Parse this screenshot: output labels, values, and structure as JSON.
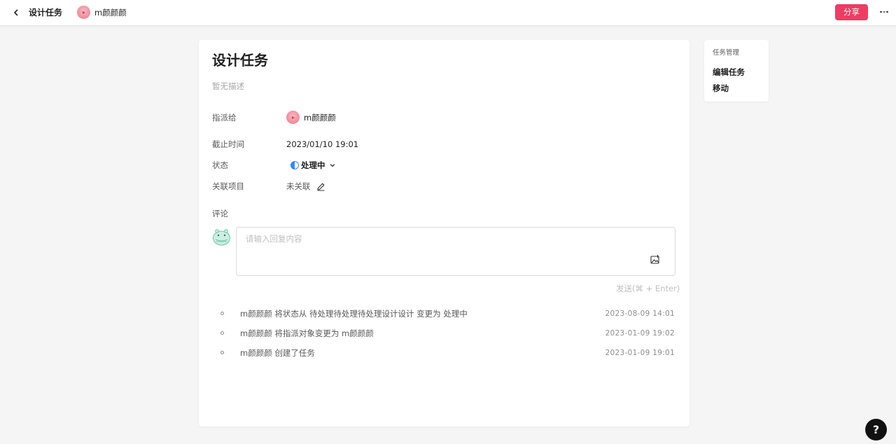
{
  "topbar": {
    "title": "设计任务",
    "user_name": "m颜颜颜",
    "share_label": "分享",
    "icons": {
      "back": "chevron-left-icon",
      "more": "more-horizontal-icon"
    }
  },
  "task": {
    "title": "设计任务",
    "description": "暂无描述",
    "fields": {
      "assignee_label": "指派给",
      "assignee_name": "m颜颜颜",
      "deadline_label": "截止时间",
      "deadline_value": "2023/01/10 19:01",
      "status_label": "状态",
      "status_value": "处理中",
      "project_label": "关联项目",
      "project_value": "未关联"
    },
    "status_color": "#2f88ff"
  },
  "comments": {
    "label": "评论",
    "placeholder": "请输入回复内容",
    "send_label": "发送(⌘ + Enter)"
  },
  "activities": [
    {
      "text": "m颜颜颜 将状态从 待处理待处理待处理设计设计 变更为 处理中",
      "time": "2023-08-09 14:01"
    },
    {
      "text": "m颜颜颜 将指派对象变更为 m颜颜颜",
      "time": "2023-01-09 19:02"
    },
    {
      "text": "m颜颜颜 创建了任务",
      "time": "2023-01-09 19:01"
    }
  ],
  "side_panel": {
    "header": "任务管理",
    "items": [
      {
        "label": "编辑任务"
      },
      {
        "label": "移动"
      }
    ]
  },
  "help": {
    "label": "?"
  },
  "colors": {
    "accent": "#ee3c63",
    "background": "#f5f5f5"
  }
}
